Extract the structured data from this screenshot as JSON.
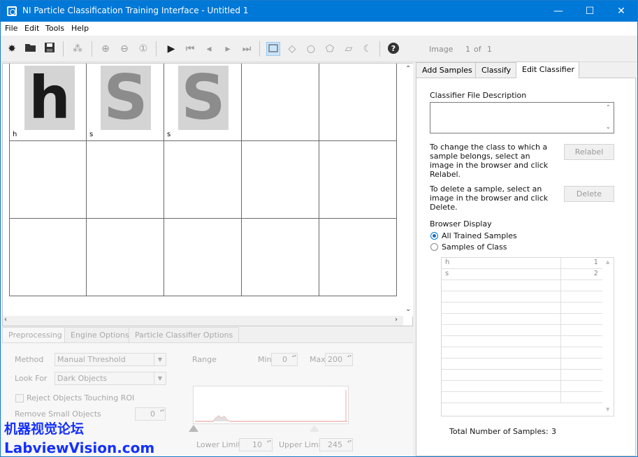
{
  "window": {
    "title": "NI Particle Classification Training Interface - Untitled 1",
    "minimize_glyph": "—",
    "maximize_glyph": "☐",
    "close_glyph": "✕"
  },
  "menu": [
    "File",
    "Edit",
    "Tools",
    "Help"
  ],
  "toolbar": {
    "image_label": "Image",
    "image_index": "1",
    "of_label": "of",
    "image_total": "1"
  },
  "browser": {
    "cells": [
      {
        "glyph": "h",
        "label": "h"
      },
      {
        "glyph": "S",
        "label": "s"
      },
      {
        "glyph": "S",
        "label": "s"
      },
      {
        "glyph": "",
        "label": ""
      },
      {
        "glyph": "",
        "label": ""
      },
      {
        "glyph": "",
        "label": ""
      },
      {
        "glyph": "",
        "label": ""
      },
      {
        "glyph": "",
        "label": ""
      },
      {
        "glyph": "",
        "label": ""
      },
      {
        "glyph": "",
        "label": ""
      },
      {
        "glyph": "",
        "label": ""
      },
      {
        "glyph": "",
        "label": ""
      },
      {
        "glyph": "",
        "label": ""
      },
      {
        "glyph": "",
        "label": ""
      },
      {
        "glyph": "",
        "label": ""
      }
    ]
  },
  "bottom_tabs": [
    "Preprocessing",
    "Engine Options",
    "Particle Classifier Options"
  ],
  "preprocessing": {
    "method_label": "Method",
    "method_value": "Manual Threshold",
    "look_for_label": "Look For",
    "look_for_value": "Dark Objects",
    "reject_label": "Reject Objects Touching ROI",
    "remove_small_label": "Remove Small Objects",
    "remove_small_value": "0",
    "range_label": "Range",
    "min_label": "Min",
    "min_value": "0",
    "max_label": "Max",
    "max_value": "200",
    "lower_limit_label": "Lower Limit",
    "lower_limit_value": "10",
    "upper_limit_label": "Upper Limit",
    "upper_limit_value": "245"
  },
  "watermark": {
    "line1": "机器视觉论坛",
    "line2": "LabviewVision.com"
  },
  "right_tabs": [
    "Add Samples",
    "Classify",
    "Edit Classifier"
  ],
  "edit_classifier": {
    "file_desc_label": "Classifier File Description",
    "file_desc_value": "",
    "relabel_text": "To change the class to which a sample belongs, select an image in the browser and click Relabel.",
    "relabel_button": "Relabel",
    "delete_text": "To delete a sample, select an image in the browser and click Delete.",
    "delete_button": "Delete",
    "browser_display_label": "Browser Display",
    "radio_all": "All Trained Samples",
    "radio_class": "Samples of Class",
    "class_rows": [
      {
        "name": "h",
        "count": "1"
      },
      {
        "name": "s",
        "count": "2"
      },
      {
        "name": "",
        "count": ""
      },
      {
        "name": "",
        "count": ""
      },
      {
        "name": "",
        "count": ""
      },
      {
        "name": "",
        "count": ""
      },
      {
        "name": "",
        "count": ""
      },
      {
        "name": "",
        "count": ""
      },
      {
        "name": "",
        "count": ""
      },
      {
        "name": "",
        "count": ""
      },
      {
        "name": "",
        "count": ""
      },
      {
        "name": "",
        "count": ""
      },
      {
        "name": "",
        "count": ""
      }
    ],
    "total_label": "Total Number of Samples:",
    "total_value": "3"
  }
}
